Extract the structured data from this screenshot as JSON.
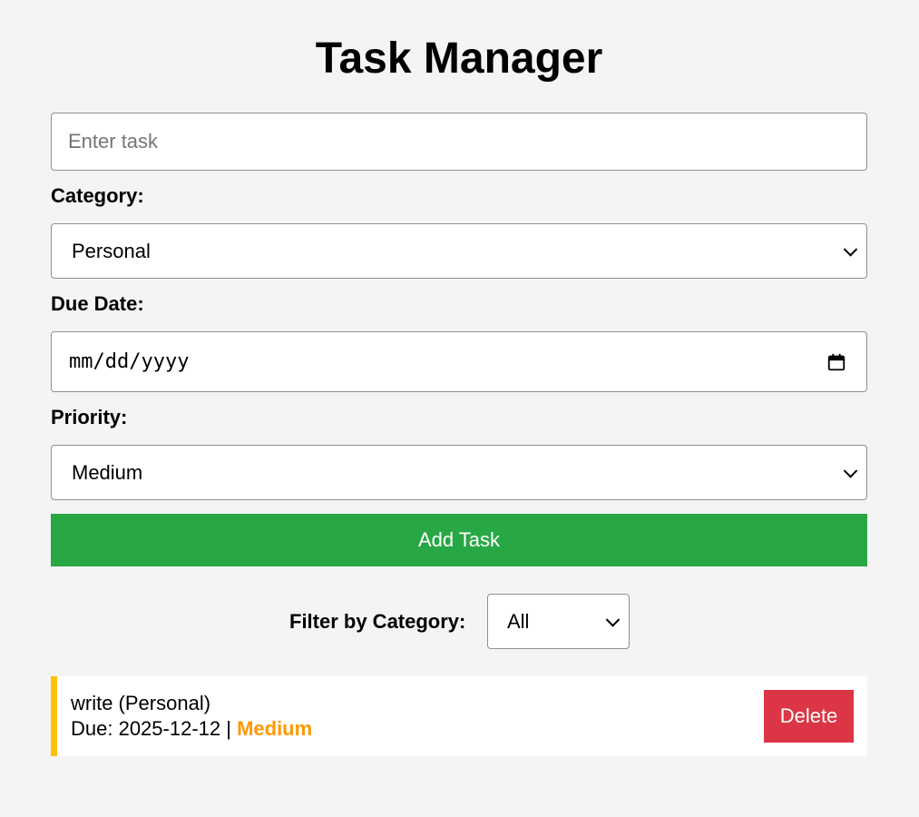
{
  "header": {
    "title": "Task Manager"
  },
  "form": {
    "task_placeholder": "Enter task",
    "category_label": "Category:",
    "category_value": "Personal",
    "due_date_label": "Due Date:",
    "due_date_placeholder": "mm/dd/yyyy",
    "priority_label": "Priority:",
    "priority_value": "Medium",
    "add_button_label": "Add Task"
  },
  "filter": {
    "label": "Filter by Category:",
    "value": "All"
  },
  "tasks": [
    {
      "title_line": "write (Personal)",
      "due_prefix": "Due: 2025-12-12 | ",
      "priority": "Medium",
      "delete_label": "Delete"
    }
  ],
  "colors": {
    "add_button": "#28a745",
    "delete_button": "#dc3545",
    "medium_priority": "#ff9800",
    "task_border": "#ffc107",
    "background": "#f4f4f4"
  },
  "icons": {
    "date_picker": "calendar-icon",
    "dropdown": "chevron-down-icon"
  }
}
